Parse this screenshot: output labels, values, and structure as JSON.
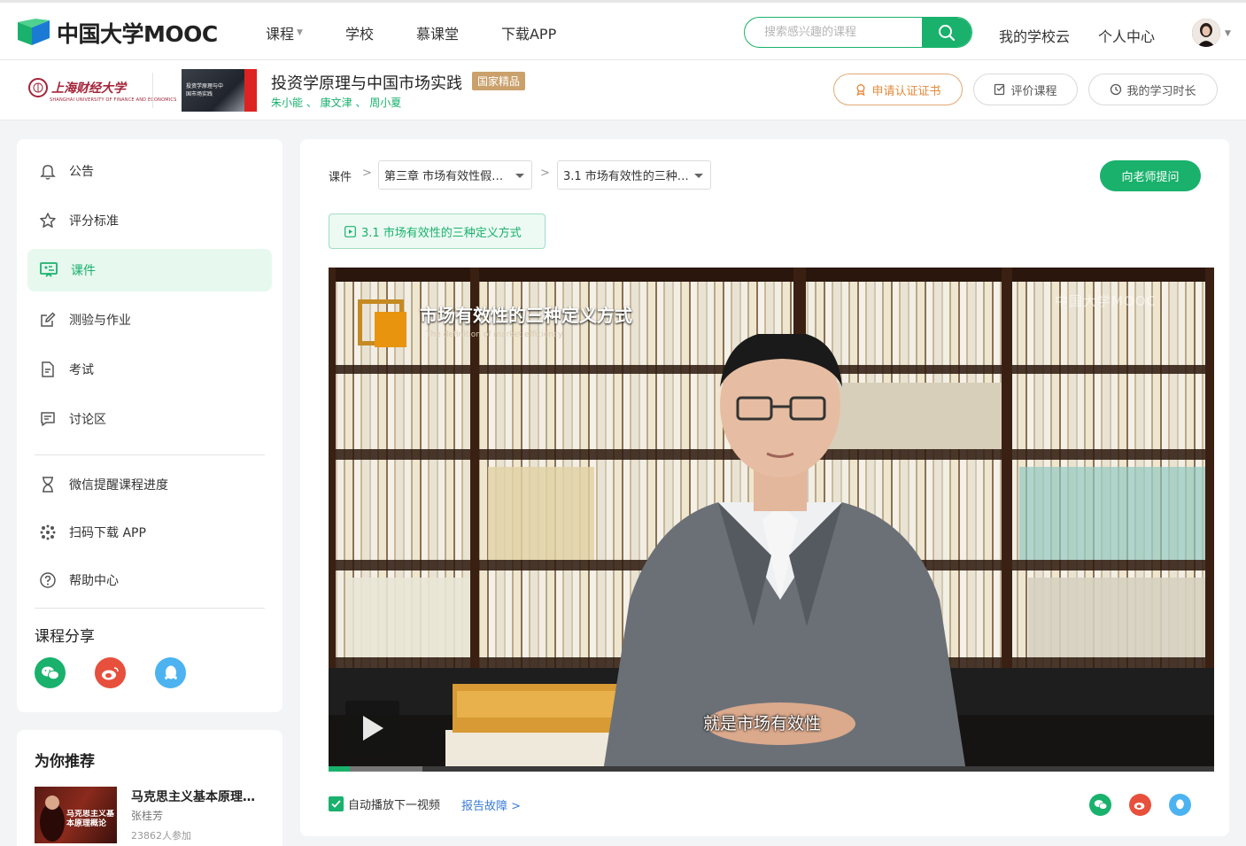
{
  "brand": {
    "name": "中国大学MOOC"
  },
  "nav": {
    "links": [
      "课程",
      "学校",
      "慕课堂",
      "下载APP"
    ],
    "search_placeholder": "搜索感兴趣的课程",
    "right_links": [
      "我的学校云",
      "个人中心"
    ]
  },
  "course": {
    "school_name": "上海财经大学",
    "school_en": "SHANGHAI UNIVERSITY OF FINANCE AND ECONOMICS",
    "thumb_text": "投资学原理与中国市场实践",
    "title": "投资学原理与中国市场实践",
    "badge": "国家精品",
    "teachers": "朱小能 、 康文津 、 周小夏",
    "buttons": {
      "certificate": "申请认证证书",
      "rate": "评价课程",
      "study_time": "我的学习时长"
    }
  },
  "sidebar": {
    "items": [
      {
        "label": "公告",
        "icon": "bell-icon"
      },
      {
        "label": "评分标准",
        "icon": "star-icon"
      },
      {
        "label": "课件",
        "icon": "courseware-icon",
        "active": true
      },
      {
        "label": "测验与作业",
        "icon": "edit-icon"
      },
      {
        "label": "考试",
        "icon": "exam-icon"
      },
      {
        "label": "讨论区",
        "icon": "discussion-icon"
      }
    ],
    "extras": [
      {
        "label": "微信提醒课程进度",
        "icon": "hourglass-icon"
      },
      {
        "label": "扫码下载 APP",
        "icon": "qr-icon"
      },
      {
        "label": "帮助中心",
        "icon": "help-icon"
      }
    ],
    "share_title": "课程分享"
  },
  "recommend": {
    "title": "为你推荐",
    "thumb_text": "马克思主义基本原理概论",
    "name": "马克思主义基本原理概论",
    "teacher": "张桂芳",
    "count": "23862人参加"
  },
  "main": {
    "crumb_label": "课件",
    "chapter_select": "第三章 市场有效性假…",
    "section_select": "3.1 市场有效性的三种…",
    "ask_button": "向老师提问",
    "unit_tab": "3.1 市场有效性的三种定义方式",
    "video": {
      "title": "市场有效性的三种定义方式",
      "subtitle_en": "The definition of market efficiency",
      "watermark": "中国大学MOOC",
      "caption": "就是市场有效性",
      "progress": 0.024,
      "buffered": 0.106
    },
    "autoplay_label": "自动播放下一视频",
    "autoplay_checked": true,
    "report_label": "报告故障 >"
  },
  "colors": {
    "accent": "#19b16c",
    "badge": "#caa06b",
    "cert": "#e48a3b",
    "link": "#3a7cd6",
    "weibo": "#e6503c",
    "qq": "#4cb3f0"
  }
}
